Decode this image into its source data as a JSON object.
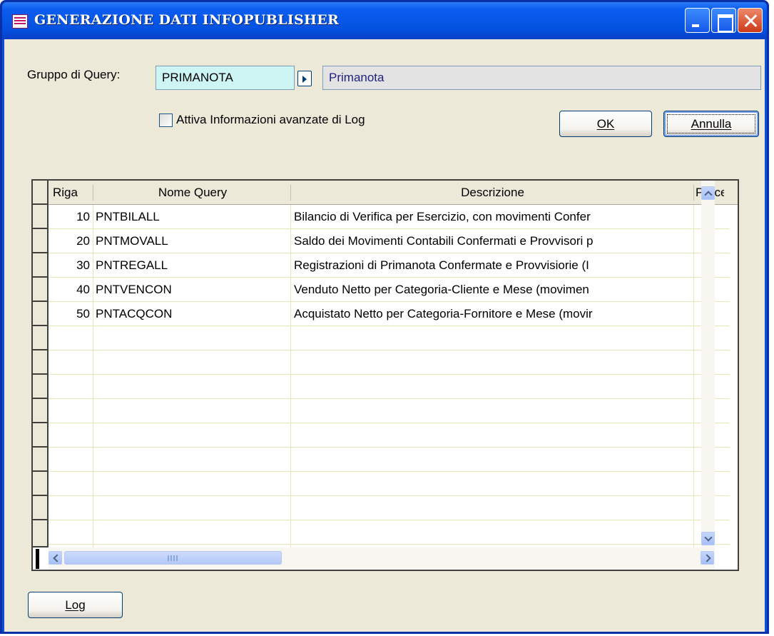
{
  "window": {
    "title": "GENERAZIONE DATI INFOPUBLISHER"
  },
  "form": {
    "group_label": "Gruppo di Query:",
    "group_code": "PRIMANOTA",
    "group_description": "Primanota",
    "checkbox_label": "Attiva Informazioni avanzate di Log",
    "checkbox_checked": false,
    "ok_label": "OK",
    "cancel_label": "Annulla",
    "log_label": "Log"
  },
  "grid": {
    "columns": [
      "Riga",
      "Nome Query",
      "Descrizione",
      "Proce"
    ],
    "rows": [
      {
        "riga": "10",
        "nome": "PNTBILALL",
        "descrizione": "Bilancio di Verifica per Esercizio, con movimenti Confer"
      },
      {
        "riga": "20",
        "nome": "PNTMOVALL",
        "descrizione": "Saldo dei Movimenti Contabili Confermati e Provvisori p"
      },
      {
        "riga": "30",
        "nome": "PNTREGALL",
        "descrizione": "Registrazioni di Primanota Confermate e Provvisiorie (I"
      },
      {
        "riga": "40",
        "nome": "PNTVENCON",
        "descrizione": "Venduto Netto per Categoria-Cliente e Mese (movimen"
      },
      {
        "riga": "50",
        "nome": "PNTACQCON",
        "descrizione": "Acquistato Netto per Categoria-Fornitore e Mese (movir"
      }
    ],
    "hscroll_thumb_icon": "grip-icon"
  },
  "colors": {
    "title_bar": "#0452e0",
    "client_bg": "#ece9d8",
    "code_field_bg": "#ccf5f3",
    "desc_field_bg": "#e3e3e3",
    "desc_text": "#1f1f80",
    "grid_line": "#e6e6b6"
  }
}
